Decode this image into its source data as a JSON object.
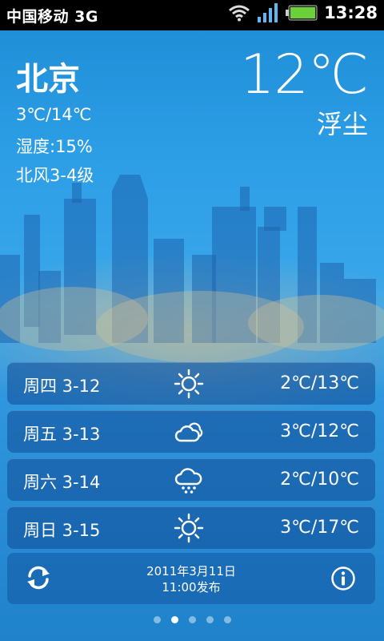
{
  "status_bar": {
    "carrier": "中国移动 3G",
    "time": "13:28"
  },
  "current": {
    "city": "北京",
    "temperature": "12℃",
    "condition": "浮尘",
    "range": "3℃/14℃",
    "humidity": "湿度:15%",
    "wind": "北风3-4级"
  },
  "forecast": [
    {
      "day": "周四 3-12",
      "icon": "sunny-icon",
      "temp": "2℃/13℃"
    },
    {
      "day": "周五 3-13",
      "icon": "cloudy-icon",
      "temp": "3℃/12℃"
    },
    {
      "day": "周六 3-14",
      "icon": "snow-icon",
      "temp": "2℃/10℃"
    },
    {
      "day": "周日 3-15",
      "icon": "sunny-icon",
      "temp": "3℃/17℃"
    }
  ],
  "footer": {
    "date": "2011年3月11日",
    "time_published": "11:00发布"
  },
  "pager": {
    "pages": 5,
    "active": 2
  },
  "colors": {
    "background": "#2c9ee6",
    "panel": "#104b96"
  }
}
